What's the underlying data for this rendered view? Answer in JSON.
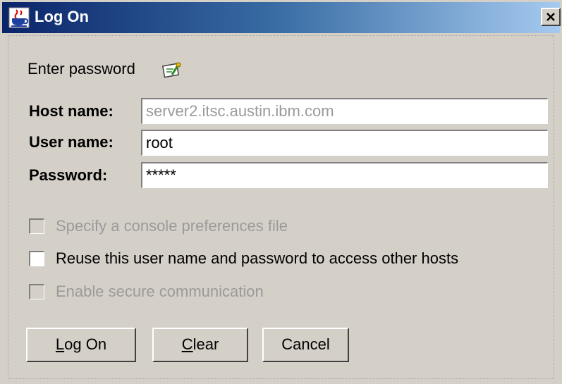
{
  "window": {
    "title": "Log On",
    "close_label": "✕"
  },
  "icons": {
    "app_icon": "java-coffee-cup-icon",
    "password_icon": "key-certificate-icon",
    "close_icon": "close-icon"
  },
  "prompt": "Enter password",
  "fields": {
    "host": {
      "label": "Host name:",
      "value": "server2.itsc.austin.ibm.com",
      "enabled": false
    },
    "user": {
      "label": "User name:",
      "value": "root"
    },
    "password": {
      "label": "Password:",
      "value": "*****"
    }
  },
  "checkboxes": [
    {
      "label": "Specify a console preferences file",
      "checked": false,
      "enabled": false
    },
    {
      "label": "Reuse this user name and password to access other hosts",
      "checked": false,
      "enabled": true
    },
    {
      "label": "Enable secure communication",
      "checked": false,
      "enabled": false
    }
  ],
  "buttons": {
    "logon": {
      "mnemonic": "L",
      "rest": "og On"
    },
    "clear": {
      "mnemonic": "C",
      "rest": "lear"
    },
    "cancel": "Cancel"
  },
  "colors": {
    "window_bg": "#d4d0c8",
    "title_gradient_start": "#0a246a",
    "title_gradient_end": "#a6caf0",
    "disabled_text": "#9a9a9a"
  }
}
